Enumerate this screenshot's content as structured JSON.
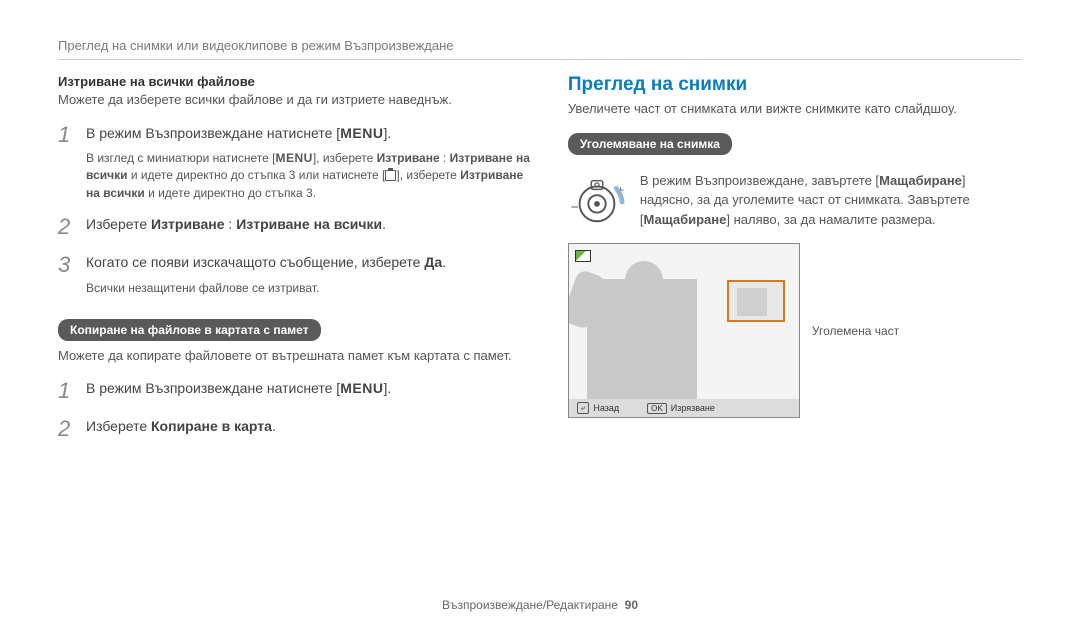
{
  "breadcrumb": "Преглед на снимки или видеоклипове в режим Възпроизвеждане",
  "left": {
    "heading_delete_all": "Изтриване на всички файлове",
    "delete_all_desc": "Можете да изберете всички файлове и да ги изтриете наведнъж.",
    "step1_a": "В режим Възпроизвеждане натиснете [",
    "menu": "MENU",
    "step1_b": "].",
    "note1_a": "В изглед с миниатюри натиснете [",
    "note1_b": "], изберете ",
    "note1_c": "Изтриване",
    "note1_d": " : ",
    "note1_e": "Изтриване на всички",
    "note1_f": " и идете директно до стъпка 3 или натиснете [",
    "note1_g": "], изберете ",
    "note1_h": "Изтриване на всички",
    "note1_i": " и идете директно до стъпка 3.",
    "step2_a": "Изберете ",
    "step2_b": "Изтриване",
    "step2_c": " : ",
    "step2_d": "Изтриване на всички",
    "step2_e": ".",
    "step3_a": "Когато се появи изскачащото съобщение, изберете ",
    "step3_b": "Да",
    "step3_c": ".",
    "note3": "Всички незащитени файлове се изтриват.",
    "pill_copy": "Копиране на файлове в картата с памет",
    "copy_desc": "Можете да копирате файловете от вътрешната памет към картата с памет.",
    "stepC1_a": "В режим Възпроизвеждане натиснете [",
    "stepC1_b": "].",
    "stepC2_a": "Изберете ",
    "stepC2_b": "Копиране в карта",
    "stepC2_c": "."
  },
  "right": {
    "title": "Преглед на снимки",
    "subtitle": "Увеличете част от снимката или вижте снимките като слайдшоу.",
    "pill_enlarge": "Уголемяване на снимка",
    "zoom_a": "В режим Възпроизвеждане, завъртете [",
    "zoom_b": "Мащабиране",
    "zoom_c": "] надясно, за да уголемите част от снимката. Завъртете [",
    "zoom_d": "Мащабиране",
    "zoom_e": "] наляво, за да намалите размера.",
    "callout": "Уголемена част",
    "back_key": "⤶",
    "back_label": "Назад",
    "ok_key": "OK",
    "ok_label": "Изрязване"
  },
  "footer": {
    "section": "Възпроизвеждане/Редактиране",
    "page": "90"
  }
}
